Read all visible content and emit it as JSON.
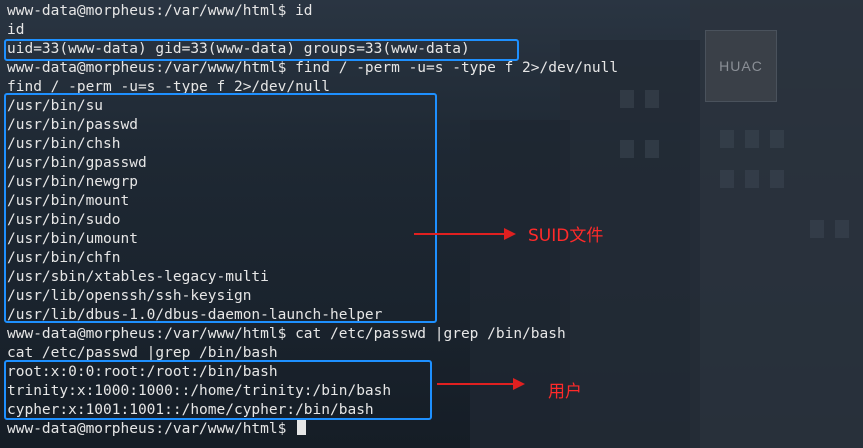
{
  "terminal": {
    "lines": [
      "www-data@morpheus:/var/www/html$ id",
      "id",
      "uid=33(www-data) gid=33(www-data) groups=33(www-data)",
      "www-data@morpheus:/var/www/html$ find / -perm -u=s -type f 2>/dev/null",
      "find / -perm -u=s -type f 2>/dev/null",
      "/usr/bin/su",
      "/usr/bin/passwd",
      "/usr/bin/chsh",
      "/usr/bin/gpasswd",
      "/usr/bin/newgrp",
      "/usr/bin/mount",
      "/usr/bin/sudo",
      "/usr/bin/umount",
      "/usr/bin/chfn",
      "/usr/sbin/xtables-legacy-multi",
      "/usr/lib/openssh/ssh-keysign",
      "/usr/lib/dbus-1.0/dbus-daemon-launch-helper",
      "www-data@morpheus:/var/www/html$ cat /etc/passwd |grep /bin/bash",
      "cat /etc/passwd |grep /bin/bash",
      "root:x:0:0:root:/root:/bin/bash",
      "trinity:x:1000:1000::/home/trinity:/bin/bash",
      "cypher:x:1001:1001::/home/cypher:/bin/bash",
      "www-data@morpheus:/var/www/html$ "
    ]
  },
  "annotations": {
    "suid_label": "SUID文件",
    "users_label": "用户"
  },
  "background": {
    "sign_text": "HUAC"
  },
  "colors": {
    "highlight_box": "#1e90ff",
    "arrow": "#e02020",
    "terminal_text": "#e6e6e6"
  }
}
